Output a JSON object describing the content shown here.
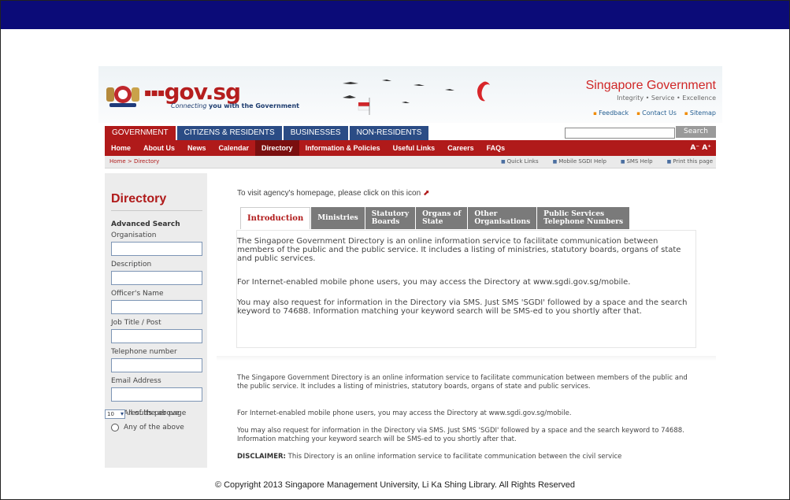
{
  "header": {
    "logo_text": "gov.sg",
    "tagline_script": "Connecting",
    "tagline_rest": "you with the Government",
    "sg_title": "Singapore Government",
    "sg_subtitle": "Integrity • Service • Excellence",
    "links": [
      "Feedback",
      "Contact Us",
      "Sitemap"
    ]
  },
  "tabs": [
    "GOVERNMENT",
    "CITIZENS & RESIDENTS",
    "BUSINESSES",
    "NON-RESIDENTS"
  ],
  "search": {
    "button": "Search",
    "value": ""
  },
  "nav": {
    "items": [
      "Home",
      "About Us",
      "News",
      "Calendar",
      "Directory",
      "Information & Policies",
      "Useful Links",
      "Careers",
      "FAQs"
    ],
    "font_size": "A⁻  A⁺"
  },
  "breadcrumb": "Home > Directory",
  "tools": [
    "Quick Links",
    "Mobile SGDI Help",
    "SMS Help",
    "Print this page"
  ],
  "sidebar": {
    "title": "Directory",
    "advanced": "Advanced Search",
    "fields": [
      "Organisation",
      "Description",
      "Officer's Name",
      "Job Title / Post",
      "Telephone number",
      "Email Address"
    ],
    "radio_all": "All of the above",
    "radio_any": "Any of the above",
    "results_value": "10",
    "results_label": "results per page"
  },
  "main": {
    "visit_text": "To visit agency's homepage, please click on this icon",
    "dir_tabs": [
      {
        "l1": "Introduction",
        "l2": ""
      },
      {
        "l1": "Ministries",
        "l2": ""
      },
      {
        "l1": "Statutory",
        "l2": "Boards"
      },
      {
        "l1": "Organs of",
        "l2": "State"
      },
      {
        "l1": "Other",
        "l2": "Organisations"
      },
      {
        "l1": "Public Services",
        "l2": "Telephone Numbers"
      }
    ],
    "intro_p1": "The Singapore Government Directory is an online information service to facilitate communication between members of the public and the public service. It includes a listing of ministries, statutory boards, organs of state and public services.",
    "intro_p2": "For Internet-enabled mobile phone users, you may access the Directory at www.sgdi.gov.sg/mobile.",
    "intro_p3": "You may also request for information in the Directory via SMS. Just SMS 'SGDI' followed by a space and the search keyword to 74688. Information matching your keyword search will be SMS-ed to you shortly after that.",
    "low_p1": "The Singapore Government Directory is an online information service to facilitate communication between members of the public and the public service. It includes a listing of ministries, statutory boards, organs of state and public services.",
    "low_p2": "For Internet-enabled mobile phone users, you may access the Directory at www.sgdi.gov.sg/mobile.",
    "low_p3": "You may also request for information in the Directory via SMS. Just SMS 'SGDI' followed by a space and the search keyword to 74688. Information matching your keyword search will be SMS-ed to you shortly after that.",
    "disclaimer_label": "DISCLAIMER:",
    "disclaimer_text": " This Directory is an online information service to facilitate communication between the civil service"
  },
  "footer": "© Copyright 2013 Singapore Management University, Li Ka Shing Library. All Rights Reserved"
}
